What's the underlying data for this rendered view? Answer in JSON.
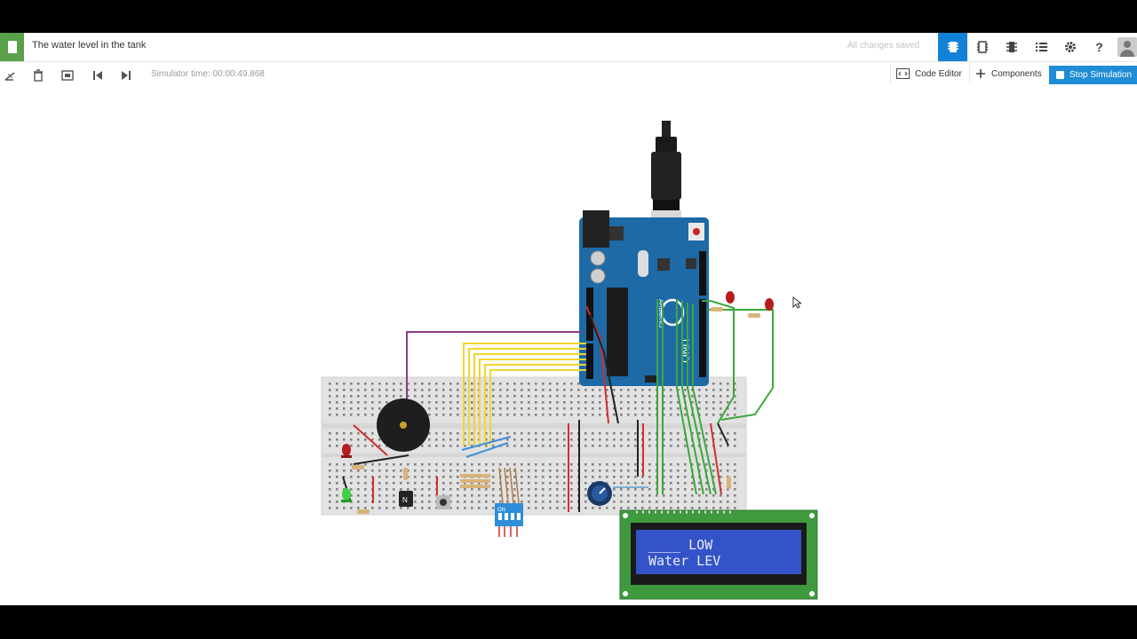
{
  "header": {
    "title": "The water level in the tank",
    "save_status": "All changes saved",
    "actions": [
      {
        "name": "circuit-view-icon",
        "active": true
      },
      {
        "name": "schematic-view-icon",
        "active": false
      },
      {
        "name": "component-list-icon",
        "active": false
      },
      {
        "name": "list-view-icon",
        "active": false
      },
      {
        "name": "settings-icon",
        "active": false
      },
      {
        "name": "help-icon",
        "active": false
      }
    ]
  },
  "toolbar": {
    "tools": [
      "rotate-icon",
      "delete-icon",
      "zoom-fit-icon",
      "step-back-icon",
      "step-forward-icon"
    ],
    "sim_time": "Simulator time: 00:00:49.868",
    "code_editor_label": "Code Editor",
    "components_label": "Components",
    "stop_label": "Stop Simulation"
  },
  "circuit": {
    "board_label": "UNO",
    "board_brand": "ARDUINO",
    "lcd_line1": "____ LOW",
    "lcd_line2": "Water LEV",
    "dip_switch_label": "ON",
    "transistor_label": "N"
  },
  "colors": {
    "accent": "#1282d6",
    "brand_green": "#5aa04a",
    "arduino_blue": "#1d6aa6",
    "lcd_bg": "#3553c8",
    "lcd_pcb": "#3f9a3f"
  }
}
